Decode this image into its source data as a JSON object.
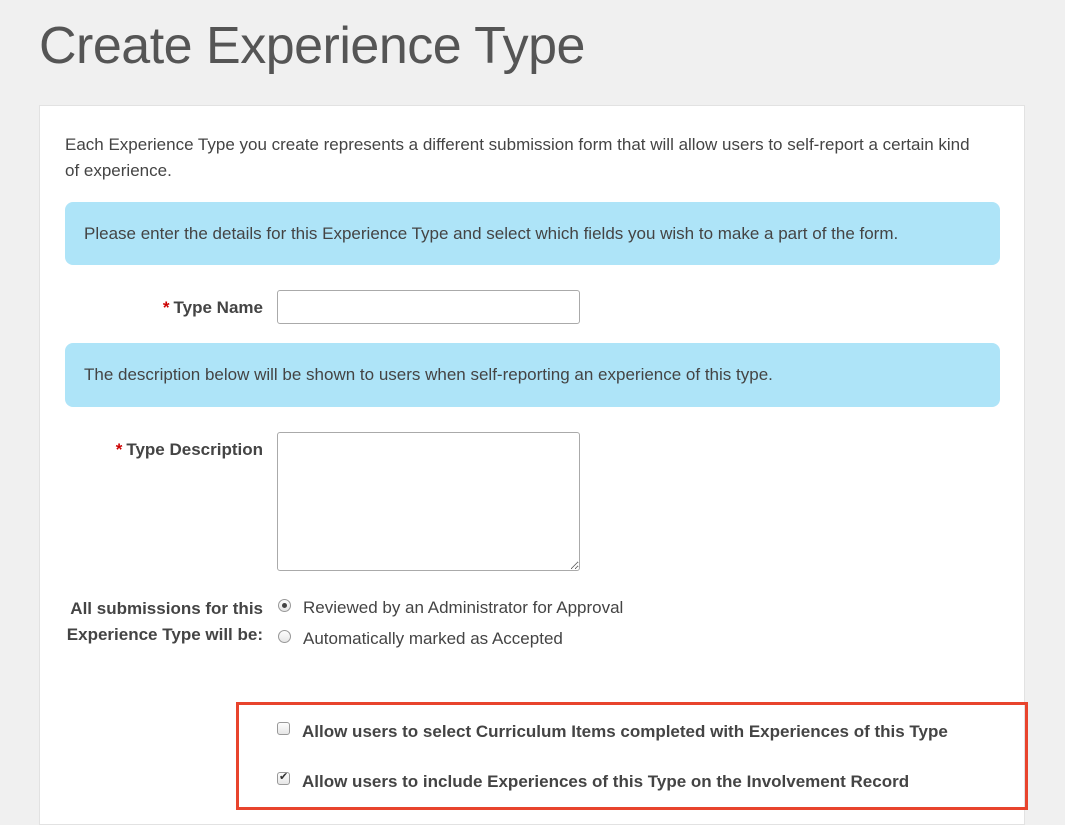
{
  "page": {
    "title": "Create Experience Type"
  },
  "panel": {
    "intro": "Each Experience Type you create represents a different submission form that will allow users to self-report a certain kind of experience.",
    "info_details": "Please enter the details for this Experience Type and select which fields you wish to make a part of the form.",
    "info_description": "The description below will be shown to users when self-reporting an experience of this type."
  },
  "form": {
    "required_marker": "*",
    "type_name": {
      "label": "Type Name",
      "value": ""
    },
    "type_description": {
      "label": "Type Description",
      "value": ""
    },
    "submissions": {
      "label": "All submissions for this Experience Type will be:",
      "options": [
        {
          "label": "Reviewed by an Administrator for Approval",
          "selected": true
        },
        {
          "label": "Automatically marked as Accepted",
          "selected": false
        }
      ]
    },
    "checkboxes": [
      {
        "label": "Allow users to select Curriculum Items completed with Experiences of this Type",
        "checked": false
      },
      {
        "label": "Allow users to include Experiences of this Type on the Involvement Record",
        "checked": true
      }
    ]
  },
  "colors": {
    "info_background": "#aee4f8",
    "required": "#cc0000",
    "highlight_border": "#e8442d"
  }
}
